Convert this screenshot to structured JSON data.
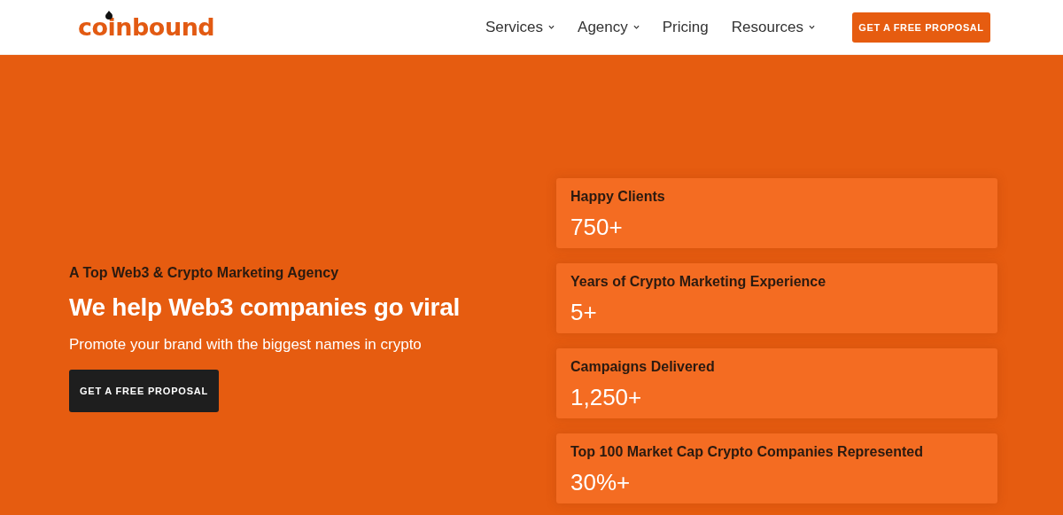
{
  "header": {
    "logo": "coinbound",
    "nav": [
      {
        "label": "Services",
        "has_menu": true
      },
      {
        "label": "Agency",
        "has_menu": true
      },
      {
        "label": "Pricing",
        "has_menu": false
      },
      {
        "label": "Resources",
        "has_menu": true
      }
    ],
    "cta": "GET A FREE PROPOSAL"
  },
  "hero": {
    "tagline": "A Top Web3 & Crypto Marketing Agency",
    "heading": "We help Web3 companies go viral",
    "subheading": "Promote your brand with the biggest names in crypto",
    "cta": "GET A FREE PROPOSAL"
  },
  "stats": [
    {
      "label": "Happy Clients",
      "value": "750+"
    },
    {
      "label": "Years of Crypto Marketing Experience",
      "value": "5+"
    },
    {
      "label": "Campaigns Delivered",
      "value": "1,250+"
    },
    {
      "label": "Top 100 Market Cap Crypto Companies Represented",
      "value": "30%+"
    }
  ]
}
